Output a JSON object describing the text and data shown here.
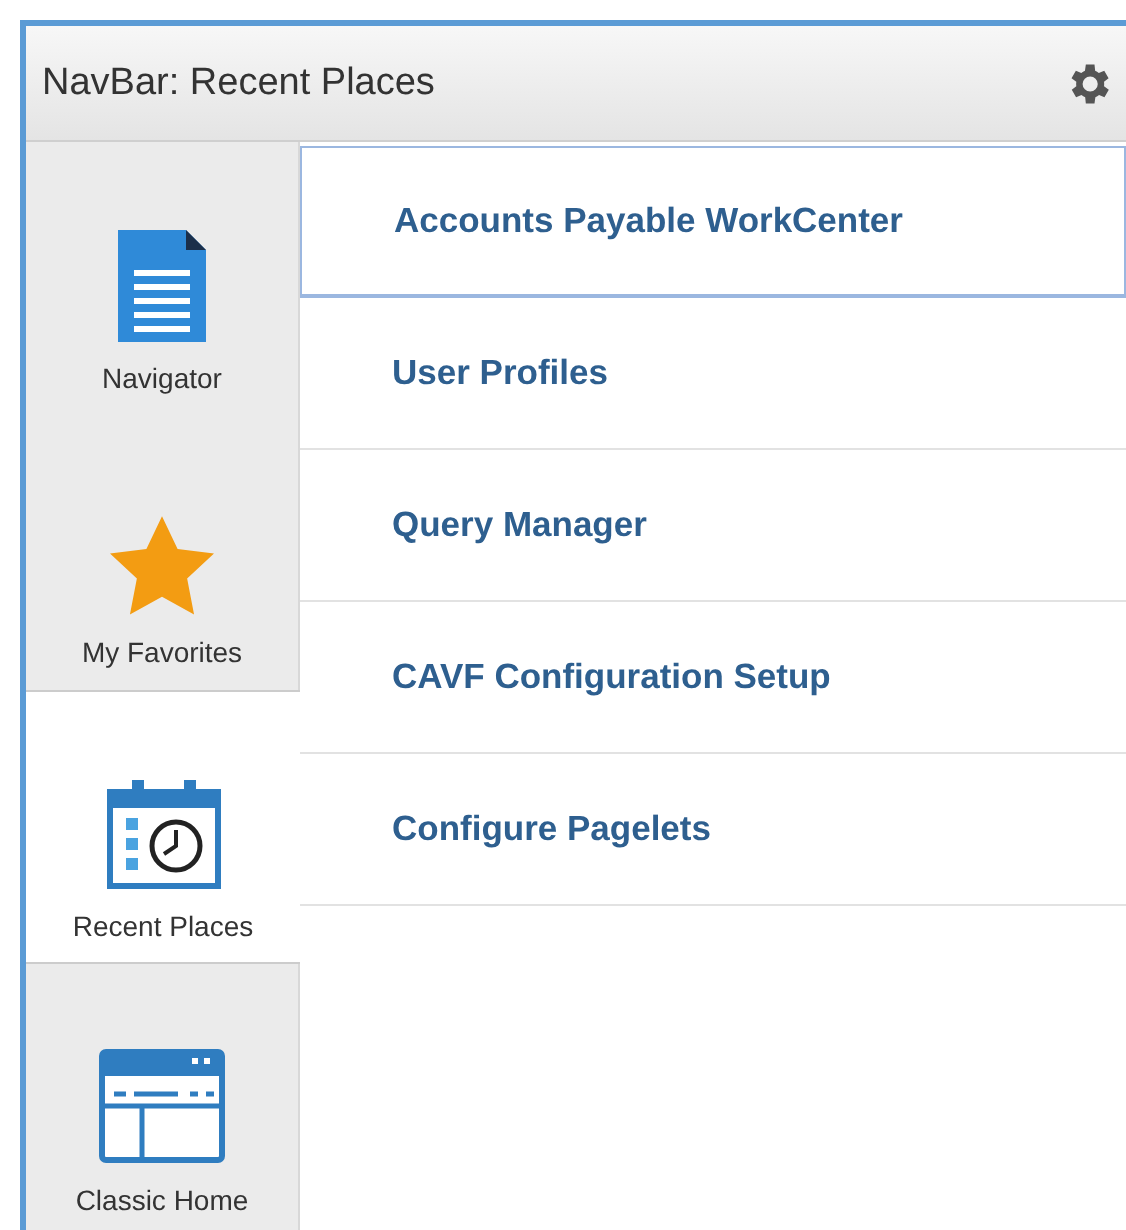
{
  "window": {
    "title": "NavBar: Recent Places"
  },
  "sidebar": {
    "items": [
      {
        "label": "Navigator",
        "kind": "navigator",
        "selected": false
      },
      {
        "label": "My Favorites",
        "kind": "favorites",
        "selected": false
      },
      {
        "label": "Recent Places",
        "kind": "recent",
        "selected": true
      },
      {
        "label": "Classic Home",
        "kind": "classic",
        "selected": false
      }
    ]
  },
  "list": {
    "items": [
      {
        "label": "Accounts Payable WorkCenter",
        "selected": true
      },
      {
        "label": "User Profiles",
        "selected": false
      },
      {
        "label": "Query Manager",
        "selected": false
      },
      {
        "label": "CAVF Configuration Setup",
        "selected": false
      },
      {
        "label": "Configure Pagelets",
        "selected": false
      }
    ]
  }
}
